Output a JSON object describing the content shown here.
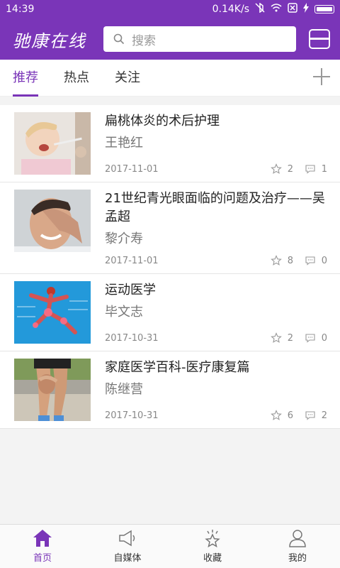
{
  "status": {
    "time": "14:39",
    "network": "0.14K/s"
  },
  "header": {
    "logo": "驰康在线",
    "search_placeholder": "搜索"
  },
  "tabs": [
    {
      "label": "推荐",
      "active": true
    },
    {
      "label": "热点",
      "active": false
    },
    {
      "label": "关注",
      "active": false
    }
  ],
  "articles": [
    {
      "title": "扁桃体炎的术后护理",
      "author": "王艳红",
      "date": "2017-11-01",
      "likes": "2",
      "comments": "1"
    },
    {
      "title": "21世纪青光眼面临的问题及治疗——吴孟超",
      "author": "黎介寿",
      "date": "2017-11-01",
      "likes": "8",
      "comments": "0"
    },
    {
      "title": "运动医学",
      "author": "毕文志",
      "date": "2017-10-31",
      "likes": "2",
      "comments": "0"
    },
    {
      "title": "家庭医学百科-医疗康复篇",
      "author": "陈继营",
      "date": "2017-10-31",
      "likes": "6",
      "comments": "2"
    }
  ],
  "bottom_nav": [
    {
      "label": "首页",
      "icon": "home-icon",
      "active": true
    },
    {
      "label": "自媒体",
      "icon": "megaphone-icon",
      "active": false
    },
    {
      "label": "收藏",
      "icon": "star-icon",
      "active": false
    },
    {
      "label": "我的",
      "icon": "user-icon",
      "active": false
    }
  ],
  "colors": {
    "brand": "#7a35b8"
  }
}
